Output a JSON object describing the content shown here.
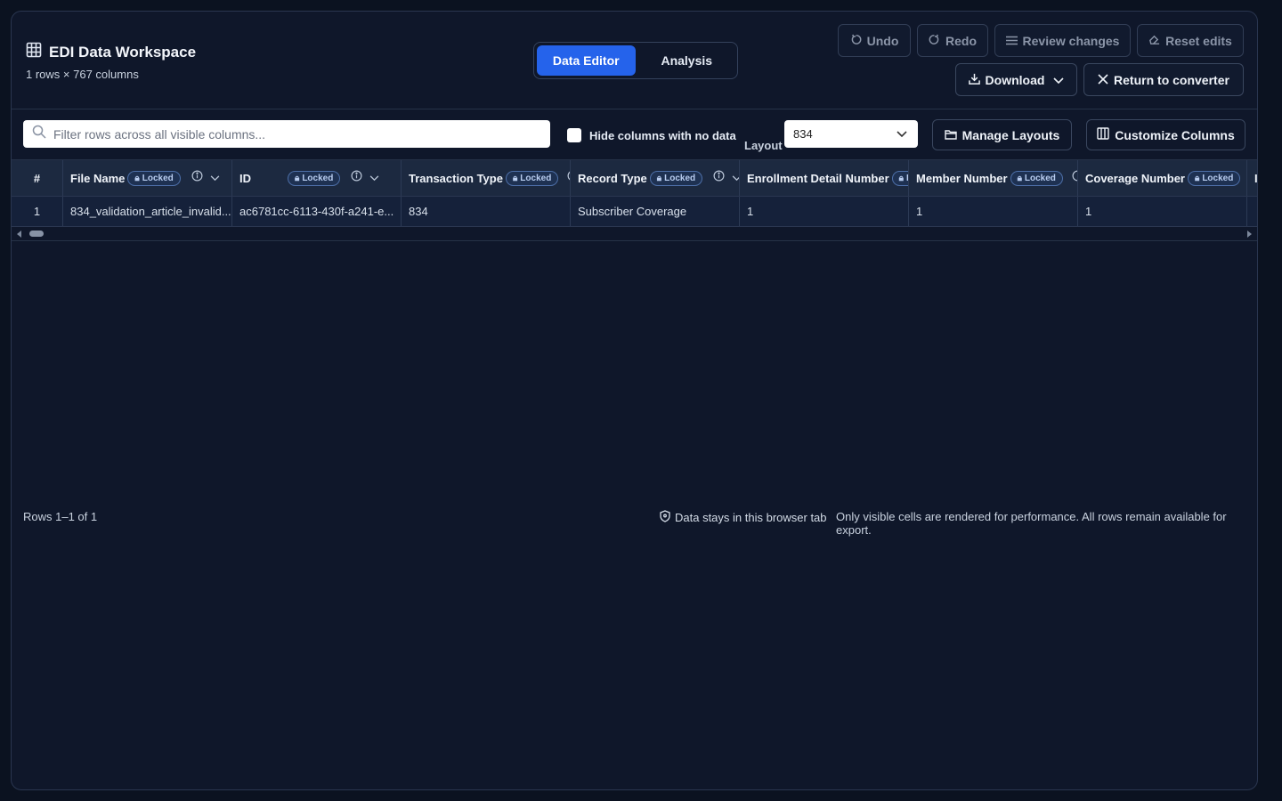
{
  "workspace": {
    "title": "EDI Data Workspace",
    "subtitle": "1 rows × 767 columns"
  },
  "tabs": [
    {
      "label": "Data Editor",
      "active": true
    },
    {
      "label": "Analysis",
      "active": false
    }
  ],
  "toolbar": {
    "undo": "Undo",
    "redo": "Redo",
    "review": "Review changes",
    "reset": "Reset edits",
    "download": "Download",
    "return": "Return to converter"
  },
  "filter": {
    "placeholder": "Filter rows across all visible columns...",
    "hide_empty_label": "Hide columns with no data",
    "hide_empty_checked": false,
    "layout_label": "Layout",
    "layout_value": "834",
    "manage_layouts": "Manage Layouts",
    "customize_columns": "Customize Columns"
  },
  "table": {
    "index_header": "#",
    "locked_label": "Locked",
    "columns": [
      "File Name",
      "ID",
      "Transaction Type",
      "Record Type",
      "Enrollment Detail Number",
      "Member Number",
      "Coverage Number"
    ],
    "rows": [
      {
        "index": "1",
        "cells": [
          "834_validation_article_invalid...",
          "ac6781cc-6113-430f-a241-e...",
          "834",
          "Subscriber Coverage",
          "1",
          "1",
          "1"
        ]
      }
    ]
  },
  "footer": {
    "rows_info": "Rows 1–1 of 1",
    "privacy": "Data stays in this browser tab",
    "performance": "Only visible cells are rendered for performance. All rows remain available for export."
  },
  "colors": {
    "background": "#0f172a",
    "accent": "#2563eb",
    "header_row": "#1c2940"
  }
}
